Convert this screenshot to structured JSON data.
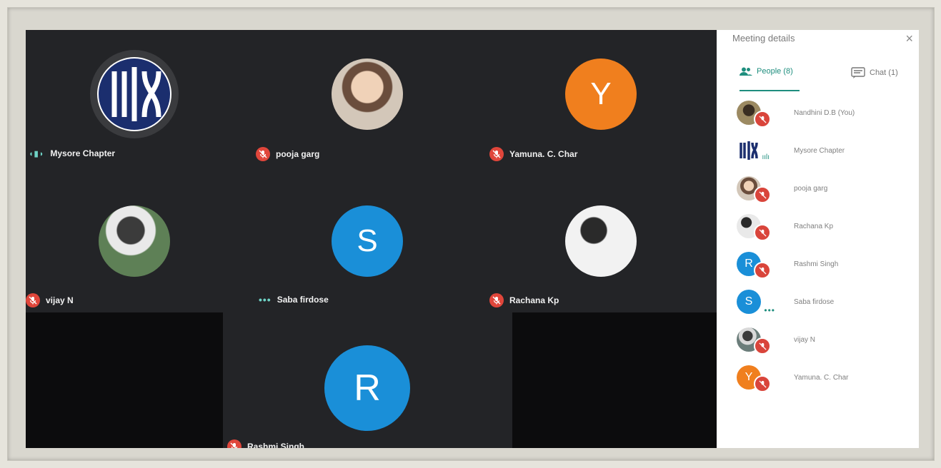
{
  "tiles": [
    {
      "name": "Mysore Chapter",
      "status": "speaking",
      "avatar_type": "logo"
    },
    {
      "name": "pooja garg",
      "status": "muted",
      "avatar_type": "photo",
      "photo_color": "#c9a98a"
    },
    {
      "name": "Yamuna. C. Char",
      "status": "muted",
      "avatar_type": "letter",
      "letter": "Y",
      "color": "#f07f1e"
    },
    {
      "name": "vijay N",
      "status": "muted",
      "avatar_type": "photo",
      "photo_color": "#6b8a5e"
    },
    {
      "name": "Saba firdose",
      "status": "dots",
      "avatar_type": "letter",
      "letter": "S",
      "color": "#1a8fd8"
    },
    {
      "name": "Rachana Kp",
      "status": "muted",
      "avatar_type": "photo",
      "photo_color": "#b6b6b6"
    },
    {
      "name": "Rashmi Singh",
      "status": "muted",
      "avatar_type": "letter",
      "letter": "R",
      "color": "#1a8fd8"
    }
  ],
  "panel": {
    "title": "Meeting details",
    "close": "×",
    "tab_people": "People (8)",
    "tab_chat": "Chat (1)",
    "people": [
      {
        "name": "Nandhini D.B (You)",
        "avatar": "photo",
        "color": "#8a7a55",
        "status": "muted"
      },
      {
        "name": "Mysore Chapter",
        "avatar": "logo",
        "color": "#1b2e6e",
        "status": "speaking"
      },
      {
        "name": "pooja garg",
        "avatar": "photo",
        "color": "#c9a98a",
        "status": "muted"
      },
      {
        "name": "Rachana Kp",
        "avatar": "photo",
        "color": "#9b9b9b",
        "status": "muted"
      },
      {
        "name": "Rashmi Singh",
        "avatar": "letter",
        "letter": "R",
        "color": "#1a8fd8",
        "status": "muted"
      },
      {
        "name": "Saba firdose",
        "avatar": "letter",
        "letter": "S",
        "color": "#1a8fd8",
        "status": "dots"
      },
      {
        "name": "vijay N",
        "avatar": "photo",
        "color": "#6b7d7a",
        "status": "muted"
      },
      {
        "name": "Yamuna. C. Char",
        "avatar": "letter",
        "letter": "Y",
        "color": "#f07f1e",
        "status": "muted"
      }
    ]
  }
}
